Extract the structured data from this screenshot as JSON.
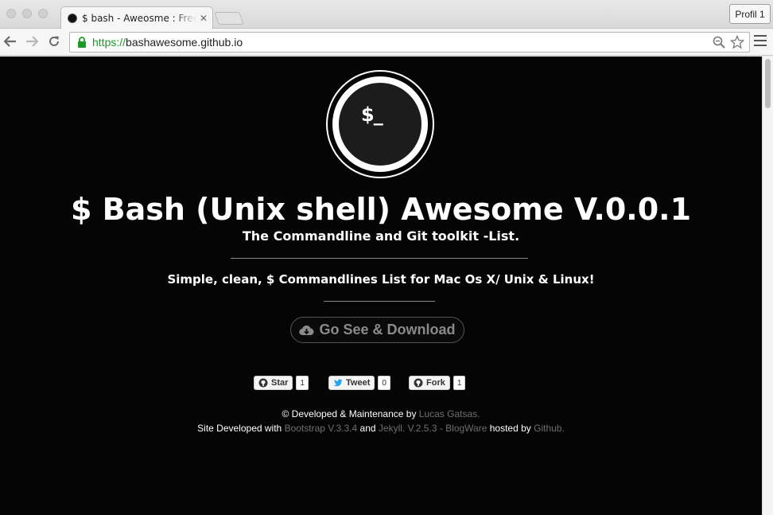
{
  "browser": {
    "tab_title": "$ bash - Aweosme : Free C",
    "tab_close": "✕",
    "profile_label": "Profil 1",
    "url_scheme": "https://",
    "url_host": "bashawesome.github.io",
    "secure_color": "#1c9a28"
  },
  "page": {
    "logo_text": "$_",
    "title": "$ Bash (Unix shell) Awesome V.0.0.1",
    "subtitle": "The Commandline and Git toolkit -List.",
    "tagline": "Simple, clean, $ Commandlines List for Mac Os X/ Unix & Linux!",
    "download_button": "Go See & Download",
    "social": {
      "star_label": "Star",
      "star_count": "1",
      "tweet_label": "Tweet",
      "tweet_count": "0",
      "fork_label": "Fork",
      "fork_count": "1"
    },
    "footer": {
      "line1_prefix": "© Developed & Maintenance by ",
      "author_link": "Lucas Gatsas.",
      "line2_prefix": "Site Developed with ",
      "bootstrap_link": "Bootstrap V.3.3.4",
      "and_text": " and ",
      "jekyll_link": "Jekyll. V.2.5.3 - BlogWare",
      "hosted_text": " hosted by ",
      "github_link": "Github."
    }
  },
  "colors": {
    "page_background": "#050505",
    "text": "#ffffff",
    "muted_link": "#6e6e6e"
  }
}
